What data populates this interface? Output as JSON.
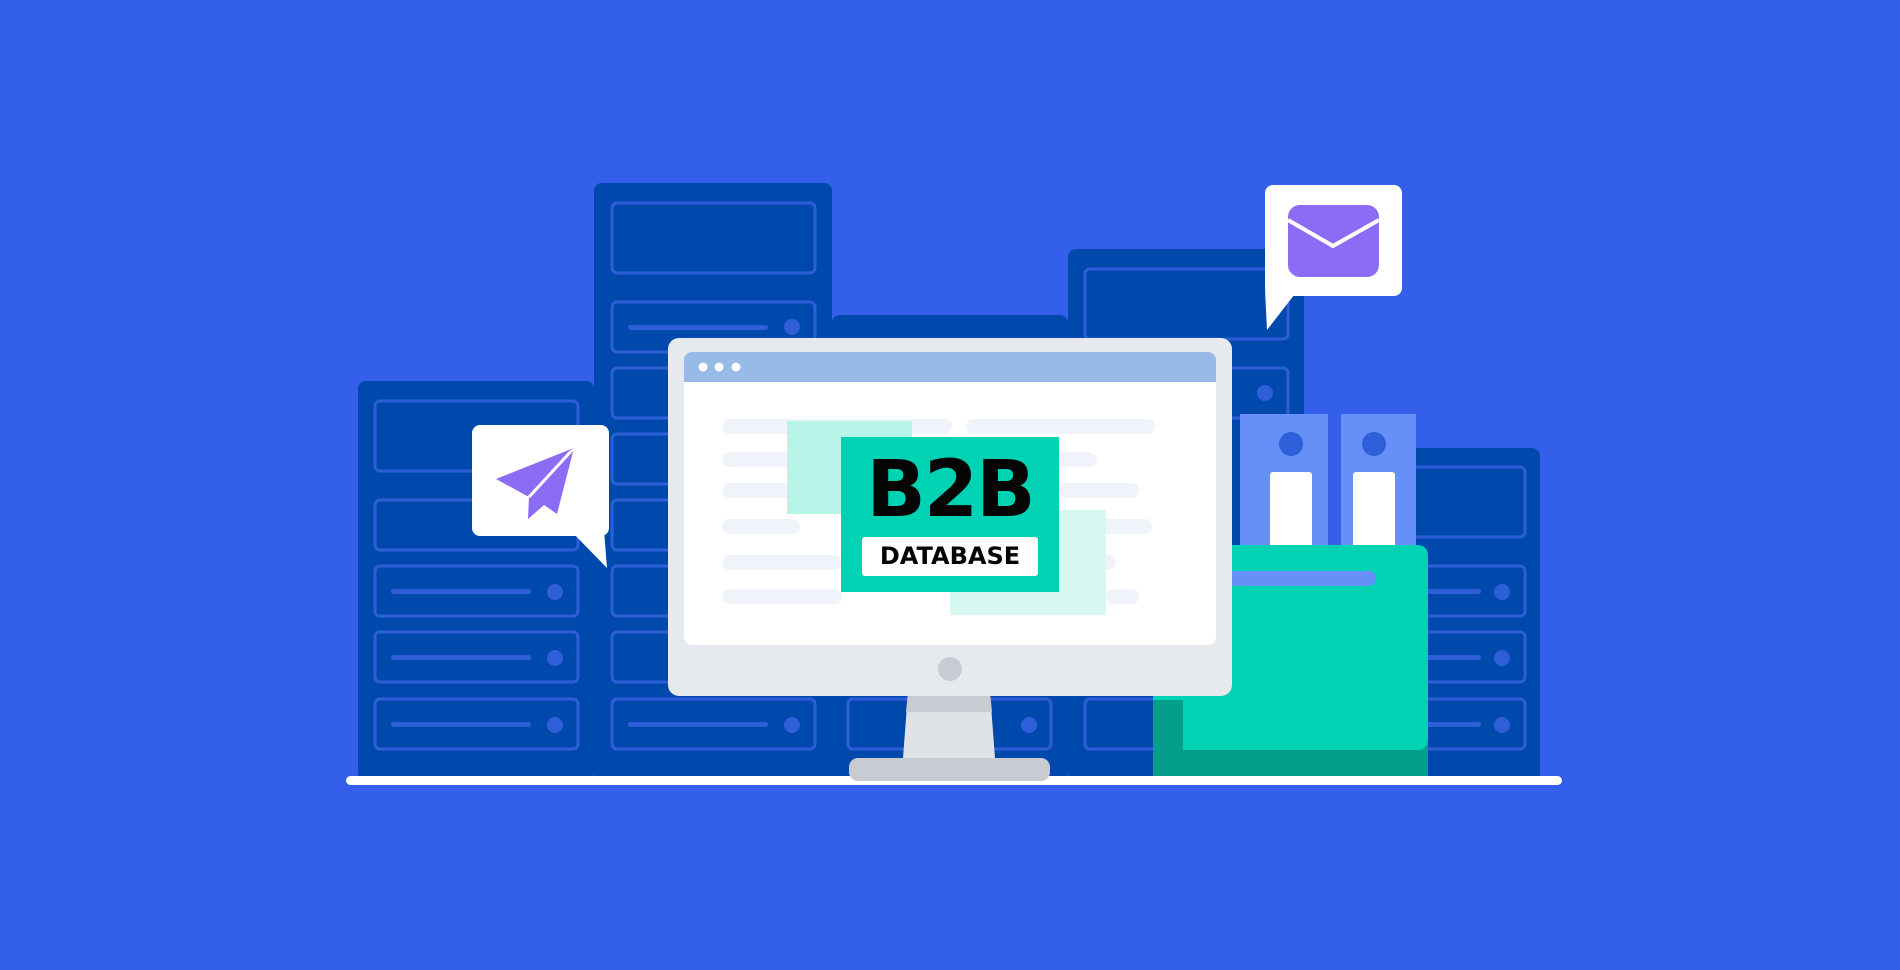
{
  "label": {
    "title": "B2B",
    "subtitle": "DATABASE"
  },
  "icons": {
    "left_bubble": "paper-plane-icon",
    "right_bubble": "envelope-icon",
    "monitor": "monitor-icon",
    "folder": "folder-icon"
  },
  "colors": {
    "background": "#335fea",
    "server": "#0049ac",
    "server_outline": "#2e5fd8",
    "accent_teal": "#00d2b3",
    "accent_purple": "#8d6cf5",
    "window_bar": "#98bae6",
    "binder": "#6690f7"
  }
}
